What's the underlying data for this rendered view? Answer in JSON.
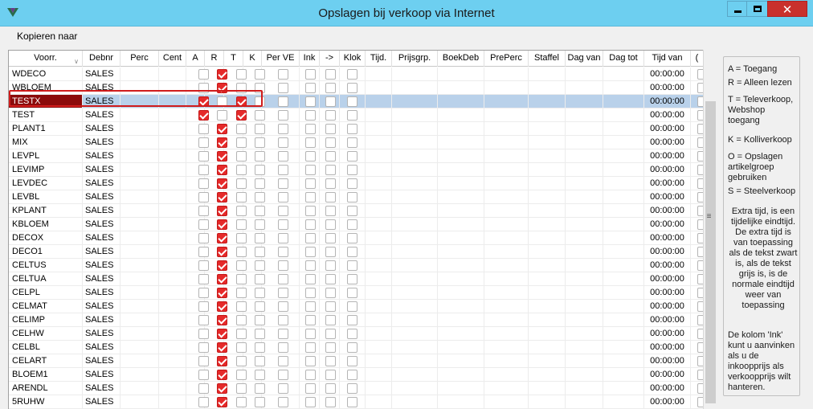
{
  "window": {
    "title": "Opslagen bij verkoop via Internet",
    "close_glyph": "✕",
    "min_icon": "minimize-icon",
    "max_icon": "maximize-icon",
    "app_icon": "app-logo-icon"
  },
  "menu": {
    "kopieren": "Kopieren naar"
  },
  "grid": {
    "columns": {
      "voorr": "Voorr.",
      "debnr": "Debnr",
      "perc": "Perc",
      "cent": "Cent",
      "a": "A",
      "r": "R",
      "t": "T",
      "k": "K",
      "perve": "Per VE",
      "ink": "Ink",
      "arrow": "->",
      "klok": "Klok",
      "tijd": "Tijd.",
      "prijsgrp": "Prijsgrp.",
      "boekdeb": "BoekDeb",
      "preperc": "PrePerc",
      "staffel": "Staffel",
      "dagvan": "Dag van",
      "dagtot": "Dag tot",
      "tijdvan": "Tijd van",
      "last": "("
    },
    "rows": [
      {
        "name": "WDECO",
        "debnr": "SALES",
        "a": false,
        "r": true,
        "t": false,
        "time": "00:00:00"
      },
      {
        "name": "WBLOEM",
        "debnr": "SALES",
        "a": false,
        "r": true,
        "t": false,
        "time": "00:00:00"
      },
      {
        "name": "TESTX",
        "debnr": "SALES",
        "a": true,
        "r": false,
        "t": true,
        "time": "00:00:00",
        "selected": true
      },
      {
        "name": "TEST",
        "debnr": "SALES",
        "a": true,
        "r": false,
        "t": true,
        "time": "00:00:00"
      },
      {
        "name": "PLANT1",
        "debnr": "SALES",
        "a": false,
        "r": true,
        "t": false,
        "time": "00:00:00"
      },
      {
        "name": "MIX",
        "debnr": "SALES",
        "a": false,
        "r": true,
        "t": false,
        "time": "00:00:00"
      },
      {
        "name": "LEVPL",
        "debnr": "SALES",
        "a": false,
        "r": true,
        "t": false,
        "time": "00:00:00"
      },
      {
        "name": "LEVIMP",
        "debnr": "SALES",
        "a": false,
        "r": true,
        "t": false,
        "time": "00:00:00"
      },
      {
        "name": "LEVDEC",
        "debnr": "SALES",
        "a": false,
        "r": true,
        "t": false,
        "time": "00:00:00"
      },
      {
        "name": "LEVBL",
        "debnr": "SALES",
        "a": false,
        "r": true,
        "t": false,
        "time": "00:00:00"
      },
      {
        "name": "KPLANT",
        "debnr": "SALES",
        "a": false,
        "r": true,
        "t": false,
        "time": "00:00:00"
      },
      {
        "name": "KBLOEM",
        "debnr": "SALES",
        "a": false,
        "r": true,
        "t": false,
        "time": "00:00:00"
      },
      {
        "name": "DECOX",
        "debnr": "SALES",
        "a": false,
        "r": true,
        "t": false,
        "time": "00:00:00"
      },
      {
        "name": "DECO1",
        "debnr": "SALES",
        "a": false,
        "r": true,
        "t": false,
        "time": "00:00:00"
      },
      {
        "name": "CELTUS",
        "debnr": "SALES",
        "a": false,
        "r": true,
        "t": false,
        "time": "00:00:00"
      },
      {
        "name": "CELTUA",
        "debnr": "SALES",
        "a": false,
        "r": true,
        "t": false,
        "time": "00:00:00"
      },
      {
        "name": "CELPL",
        "debnr": "SALES",
        "a": false,
        "r": true,
        "t": false,
        "time": "00:00:00"
      },
      {
        "name": "CELMAT",
        "debnr": "SALES",
        "a": false,
        "r": true,
        "t": false,
        "time": "00:00:00"
      },
      {
        "name": "CELIMP",
        "debnr": "SALES",
        "a": false,
        "r": true,
        "t": false,
        "time": "00:00:00"
      },
      {
        "name": "CELHW",
        "debnr": "SALES",
        "a": false,
        "r": true,
        "t": false,
        "time": "00:00:00"
      },
      {
        "name": "CELBL",
        "debnr": "SALES",
        "a": false,
        "r": true,
        "t": false,
        "time": "00:00:00"
      },
      {
        "name": "CELART",
        "debnr": "SALES",
        "a": false,
        "r": true,
        "t": false,
        "time": "00:00:00"
      },
      {
        "name": "BLOEM1",
        "debnr": "SALES",
        "a": false,
        "r": true,
        "t": false,
        "time": "00:00:00"
      },
      {
        "name": "ARENDL",
        "debnr": "SALES",
        "a": false,
        "r": true,
        "t": false,
        "time": "00:00:00"
      },
      {
        "name": "5RUHW",
        "debnr": "SALES",
        "a": false,
        "r": true,
        "t": false,
        "time": "00:00:00"
      }
    ]
  },
  "info": {
    "p1": "A = Toegang",
    "p2": "R = Alleen lezen",
    "p3": "T = Televerkoop, Webshop toegang",
    "p4": "K = Kolliverkoop",
    "p5": "O = Opslagen artikelgroep gebruiken",
    "p6": "S = Steelverkoop",
    "p7": "Extra tijd, is een tijdelijke eindtijd. De extra tijd is van toepassing als de tekst zwart is, als de tekst grijs is, is de normale eindtijd weer van toepassing",
    "p8": "De kolom 'Ink' kunt u aanvinken als u de inkoopprijs als verkoopprijs wilt hanteren."
  },
  "colors": {
    "titlebar": "#6dcff0",
    "close": "#c9302c",
    "check_on": "#e52a2a",
    "selected_row": "#b9d1ea",
    "selected_name": "#8b0a0a"
  }
}
